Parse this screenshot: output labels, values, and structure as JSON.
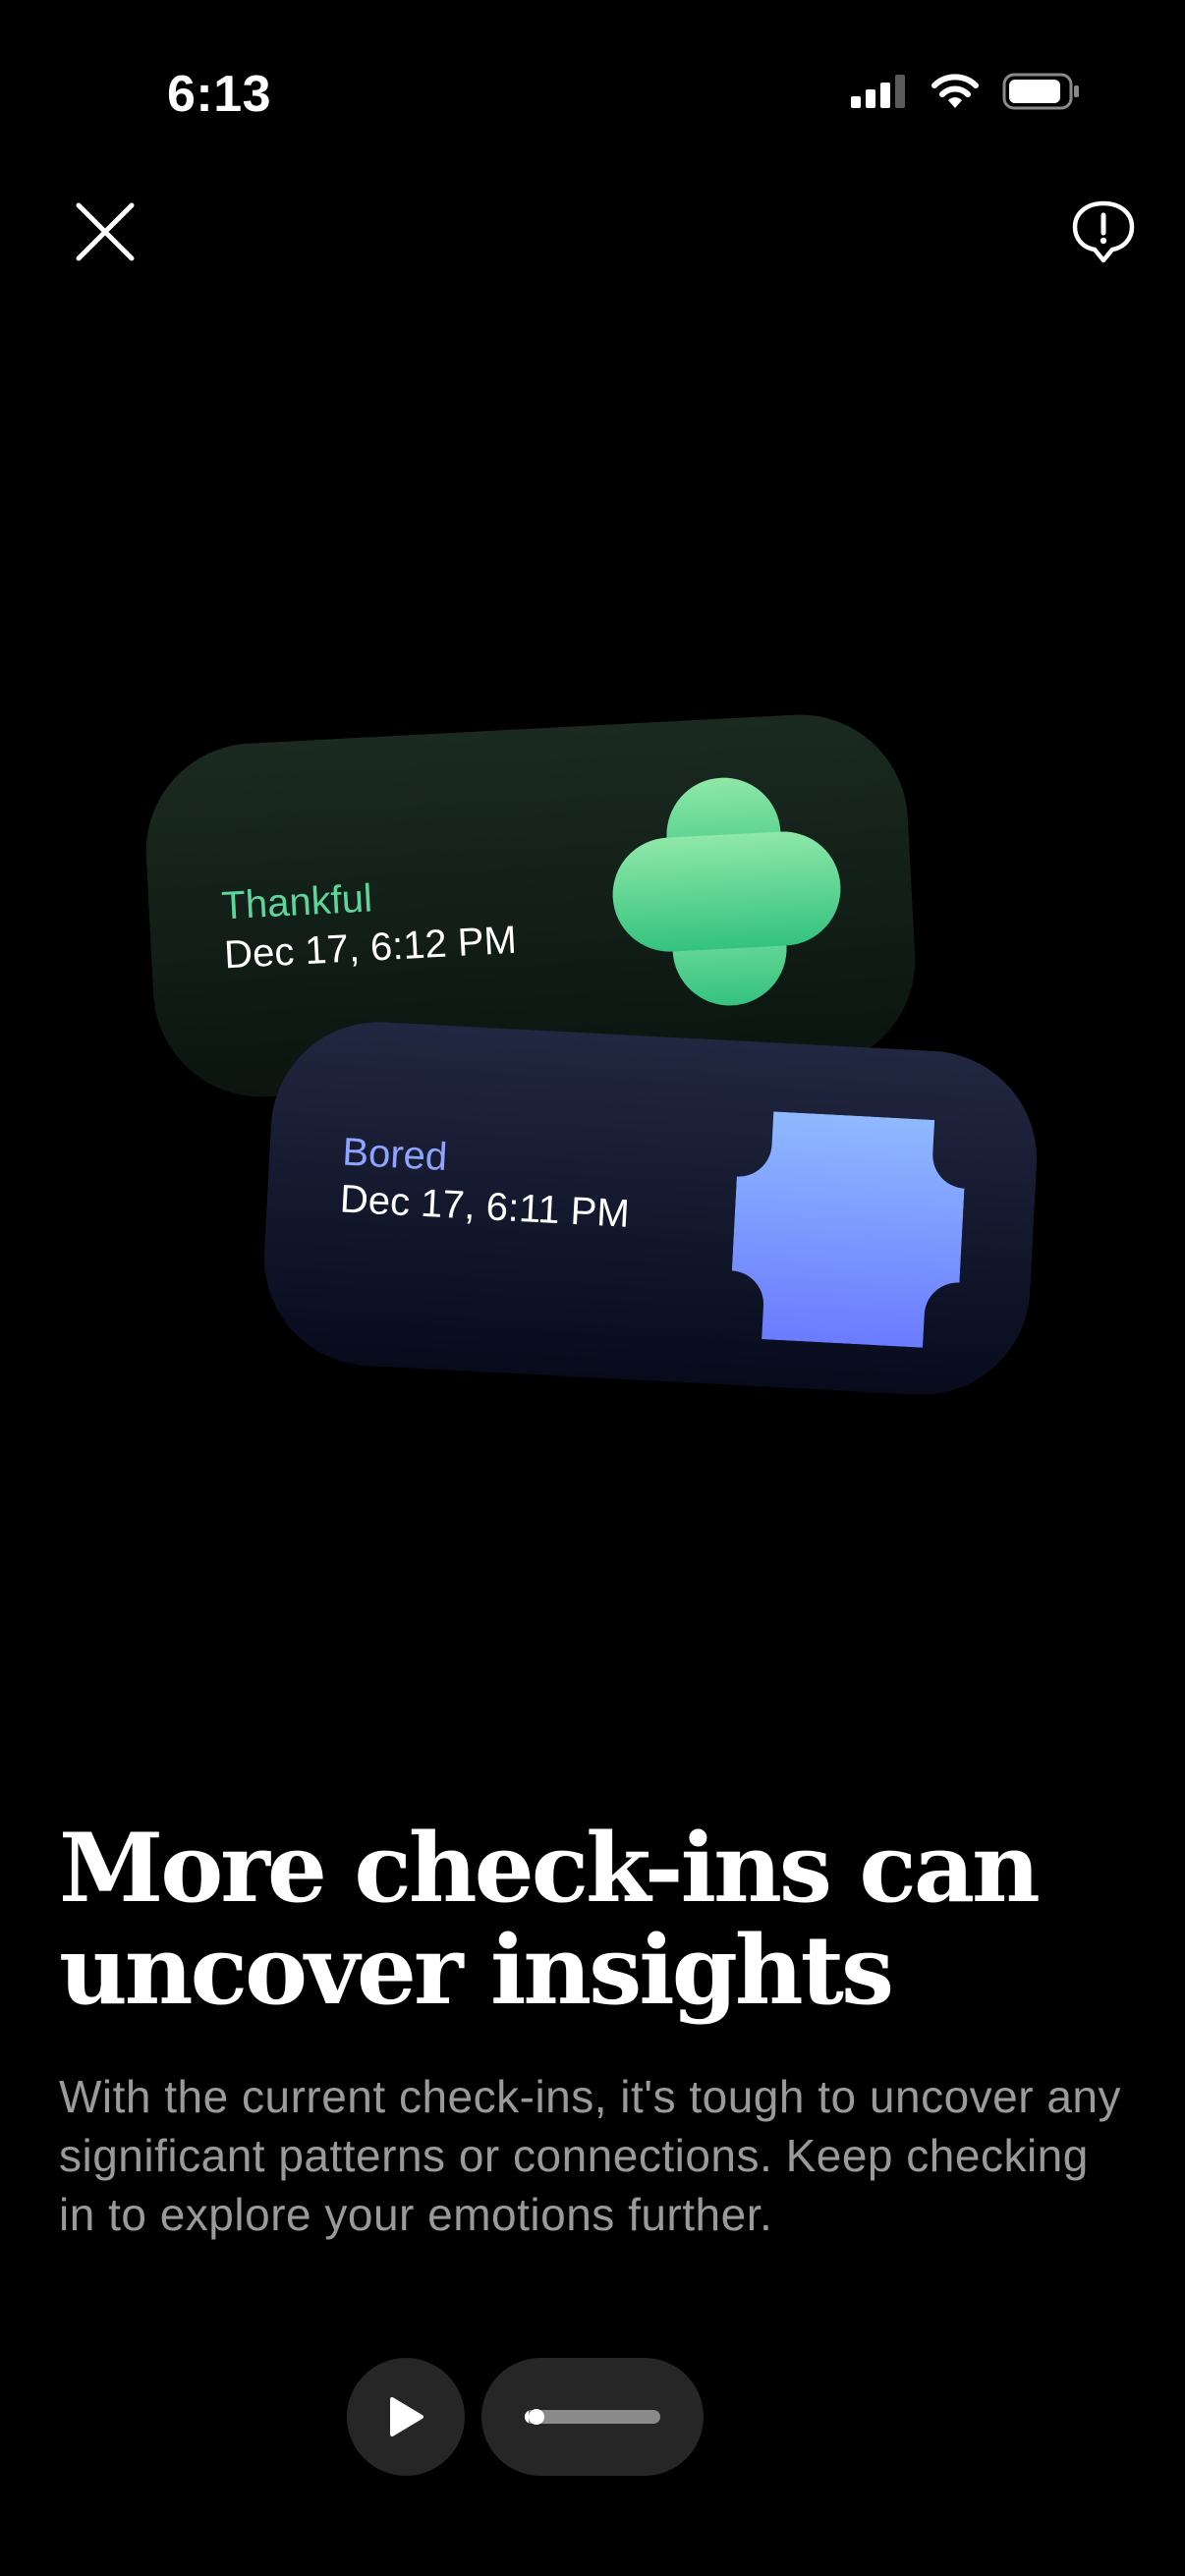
{
  "status_bar": {
    "time": "6:13",
    "icons": [
      "cellular-signal-icon",
      "wifi-icon",
      "battery-icon"
    ]
  },
  "toolbar": {
    "close_icon": "close-icon",
    "feedback_icon": "feedback-icon"
  },
  "cards": [
    {
      "emotion": "Thankful",
      "datetime": "Dec 17, 6:12 PM",
      "color": "#5ed59a",
      "shape": "clover"
    },
    {
      "emotion": "Bored",
      "datetime": "Dec 17, 6:11 PM",
      "color": "#8ea4ff",
      "shape": "notched-square"
    }
  ],
  "content": {
    "title": "More check-ins can uncover insights",
    "body": "With the current check-ins, it's tough to uncover any significant patterns or connections. Keep checking in to explore your emotions further."
  },
  "player": {
    "play_icon": "play-icon",
    "progress": 0.03
  },
  "colors": {
    "background": "#000000",
    "green_accent": "#5ed59a",
    "blue_accent": "#8ea4ff"
  }
}
